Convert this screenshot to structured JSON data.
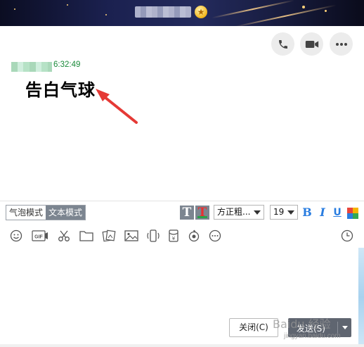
{
  "message": {
    "time": "6:32:49",
    "text": "告白气球"
  },
  "mode_toggle": {
    "bubble_label": "气泡模式",
    "text_label": "文本模式",
    "active": "text"
  },
  "format_toolbar": {
    "font_family": "方正粗...",
    "font_size": "19",
    "bold_label": "B",
    "italic_label": "I",
    "underline_label": "U",
    "text_style_label": "T",
    "text_color_label": "T"
  },
  "buttons": {
    "close_label": "关闭(C)",
    "send_label": "发送(S)"
  },
  "watermark": {
    "text": "Baidu 经验",
    "url": "jingyan.baidu.com"
  },
  "icons": {
    "top": [
      "phone-icon",
      "video-icon",
      "more-icon"
    ],
    "tools": [
      "emoji-icon",
      "gif-icon",
      "screenshot-scissors-icon",
      "folder-icon",
      "gallery-icon",
      "image-icon",
      "shake-icon",
      "red-packet-icon",
      "voice-icon",
      "more-tools-icon",
      "history-clock-icon"
    ]
  },
  "colors": {
    "accent_dark": "#5f6570",
    "time_green": "#1a8a3a",
    "arrow_red": "#e53935",
    "bold_blue": "#2a7de0"
  }
}
